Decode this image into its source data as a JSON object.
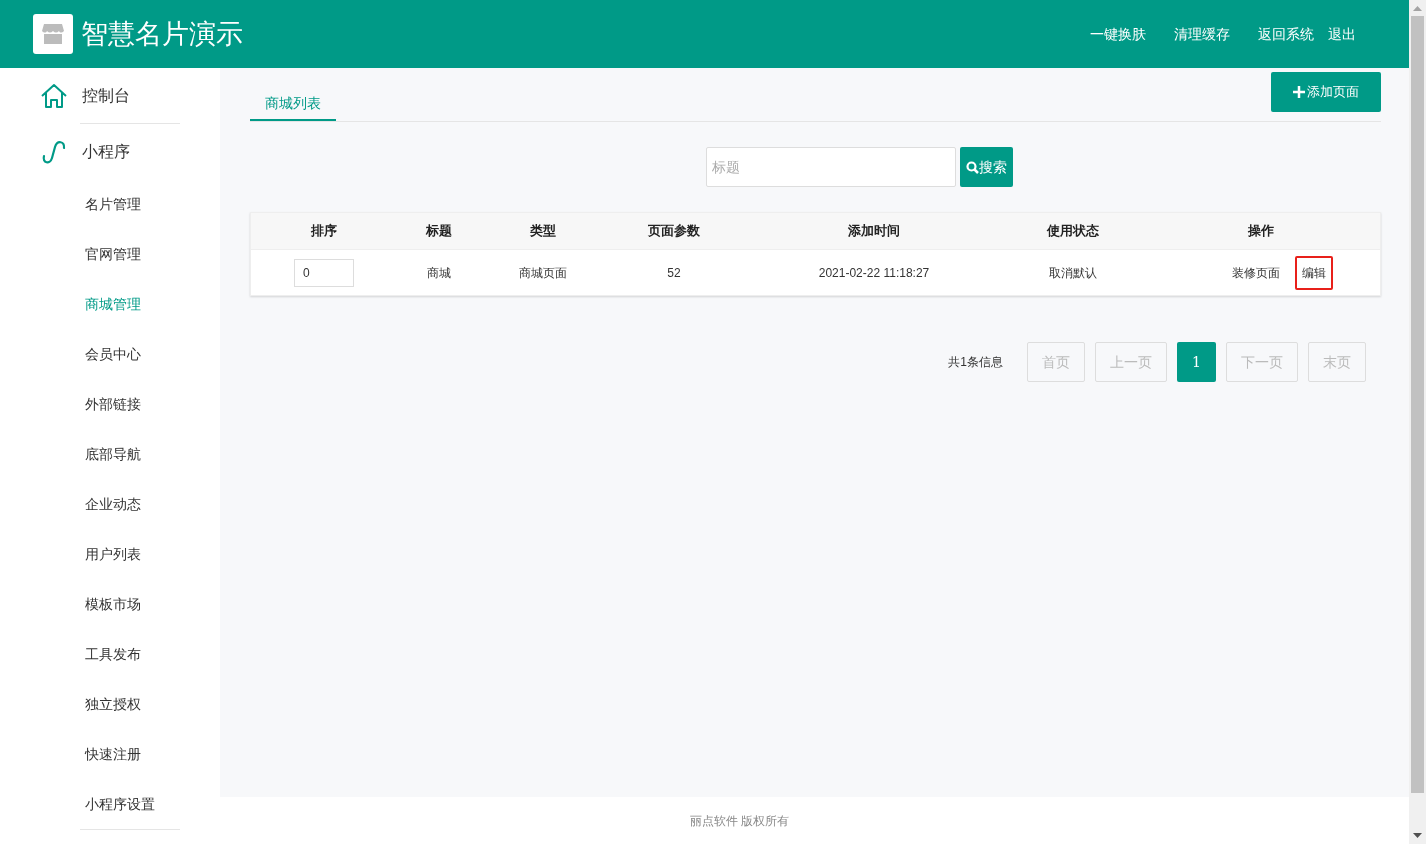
{
  "header": {
    "title": "智慧名片演示",
    "links": [
      "一键换肤",
      "清理缓存",
      "返回系统",
      "退出"
    ]
  },
  "sidebar": {
    "items": [
      {
        "label": "控制台",
        "kind": "home",
        "selected": false
      },
      {
        "label": "小程序",
        "kind": "miniapp",
        "selected": false,
        "children": [
          {
            "label": "名片管理",
            "selected": false
          },
          {
            "label": "官网管理",
            "selected": false
          },
          {
            "label": "商城管理",
            "selected": true
          },
          {
            "label": "会员中心",
            "selected": false
          },
          {
            "label": "外部链接",
            "selected": false
          },
          {
            "label": "底部导航",
            "selected": false
          },
          {
            "label": "企业动态",
            "selected": false
          },
          {
            "label": "用户列表",
            "selected": false
          },
          {
            "label": "模板市场",
            "selected": false
          },
          {
            "label": "工具发布",
            "selected": false
          },
          {
            "label": "独立授权",
            "selected": false
          },
          {
            "label": "快速注册",
            "selected": false
          },
          {
            "label": "小程序设置",
            "selected": false
          }
        ]
      }
    ]
  },
  "tabs": [
    {
      "label": "商城列表",
      "selected": true
    }
  ],
  "add_button": "添加页面",
  "search": {
    "placeholder": "标题",
    "button": "搜索"
  },
  "table": {
    "columns": [
      "排序",
      "标题",
      "类型",
      "页面参数",
      "添加时间",
      "使用状态",
      "操作"
    ],
    "rows": [
      {
        "sort": "0",
        "title": "商城",
        "type": "商城页面",
        "params": "52",
        "time": "2021-02-22 11:18:27",
        "status": "取消默认",
        "actions": [
          {
            "label": "装修页面",
            "highlighted": false
          },
          {
            "label": "编辑",
            "highlighted": true
          }
        ]
      }
    ]
  },
  "pagination": {
    "summary": "共1条信息",
    "buttons": [
      {
        "label": "首页",
        "selected": false
      },
      {
        "label": "上一页",
        "selected": false
      },
      {
        "label": "1",
        "selected": true
      },
      {
        "label": "下一页",
        "selected": false
      },
      {
        "label": "末页",
        "selected": false
      }
    ]
  },
  "footer": "丽点软件 版权所有"
}
